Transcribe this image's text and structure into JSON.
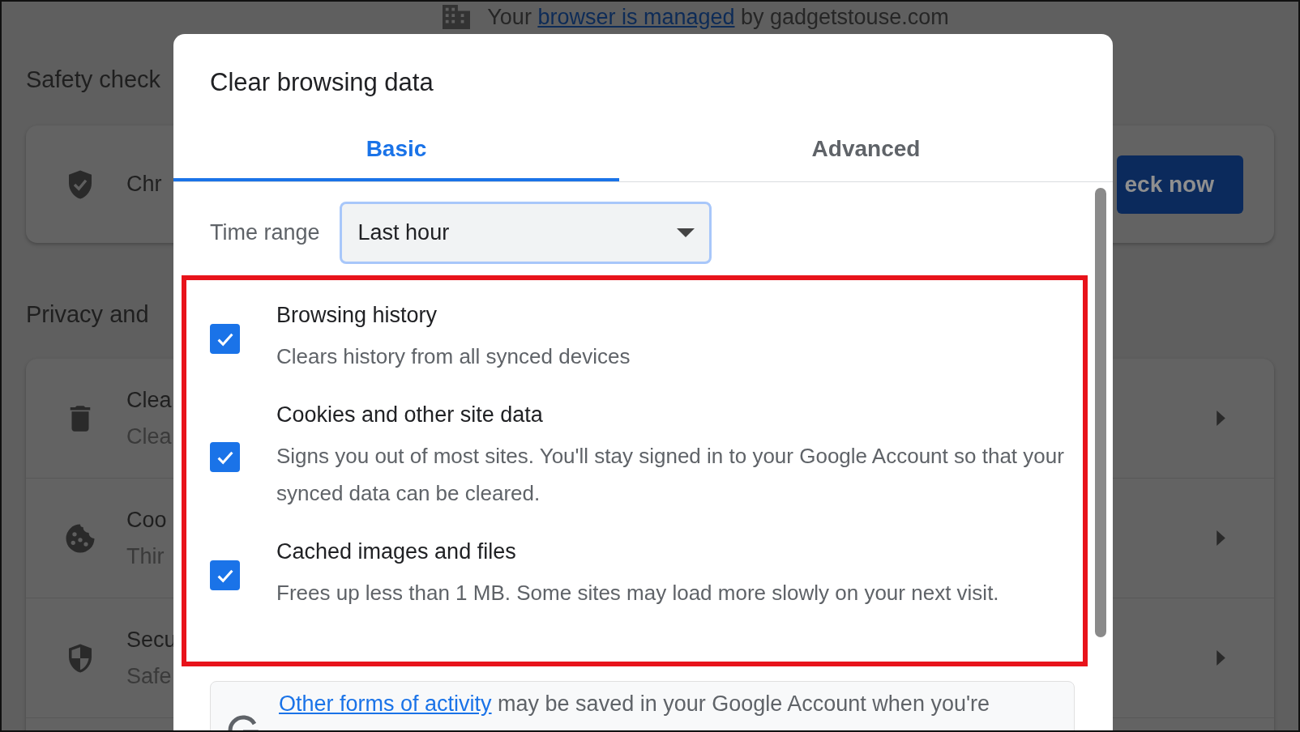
{
  "banner": {
    "before": "Your",
    "link": "browser is managed",
    "after": "by gadgetstouse.com"
  },
  "settings": {
    "safety_heading": "Safety check",
    "safety_row": "Chr",
    "check_button": "eck now",
    "privacy_heading": "Privacy and",
    "privacy_rows": [
      {
        "title": "Clea",
        "subtitle": "Clea"
      },
      {
        "title": "Coo",
        "subtitle": "Thir"
      },
      {
        "title": "Secu",
        "subtitle": "Safe"
      }
    ]
  },
  "dialog": {
    "title": "Clear browsing data",
    "tabs": [
      {
        "label": "Basic",
        "selected": true
      },
      {
        "label": "Advanced",
        "selected": false
      }
    ],
    "time_range": {
      "label": "Time range",
      "value": "Last hour"
    },
    "options": [
      {
        "title": "Browsing history",
        "description": "Clears history from all synced devices",
        "checked": true
      },
      {
        "title": "Cookies and other site data",
        "description": "Signs you out of most sites. You'll stay signed in to your Google Account so that your synced data can be cleared.",
        "checked": true
      },
      {
        "title": "Cached images and files",
        "description": "Frees up less than 1 MB. Some sites may load more slowly on your next visit.",
        "checked": true
      }
    ],
    "notice": {
      "link": "Other forms of activity",
      "text": "may be saved in your Google Account when you're"
    }
  }
}
